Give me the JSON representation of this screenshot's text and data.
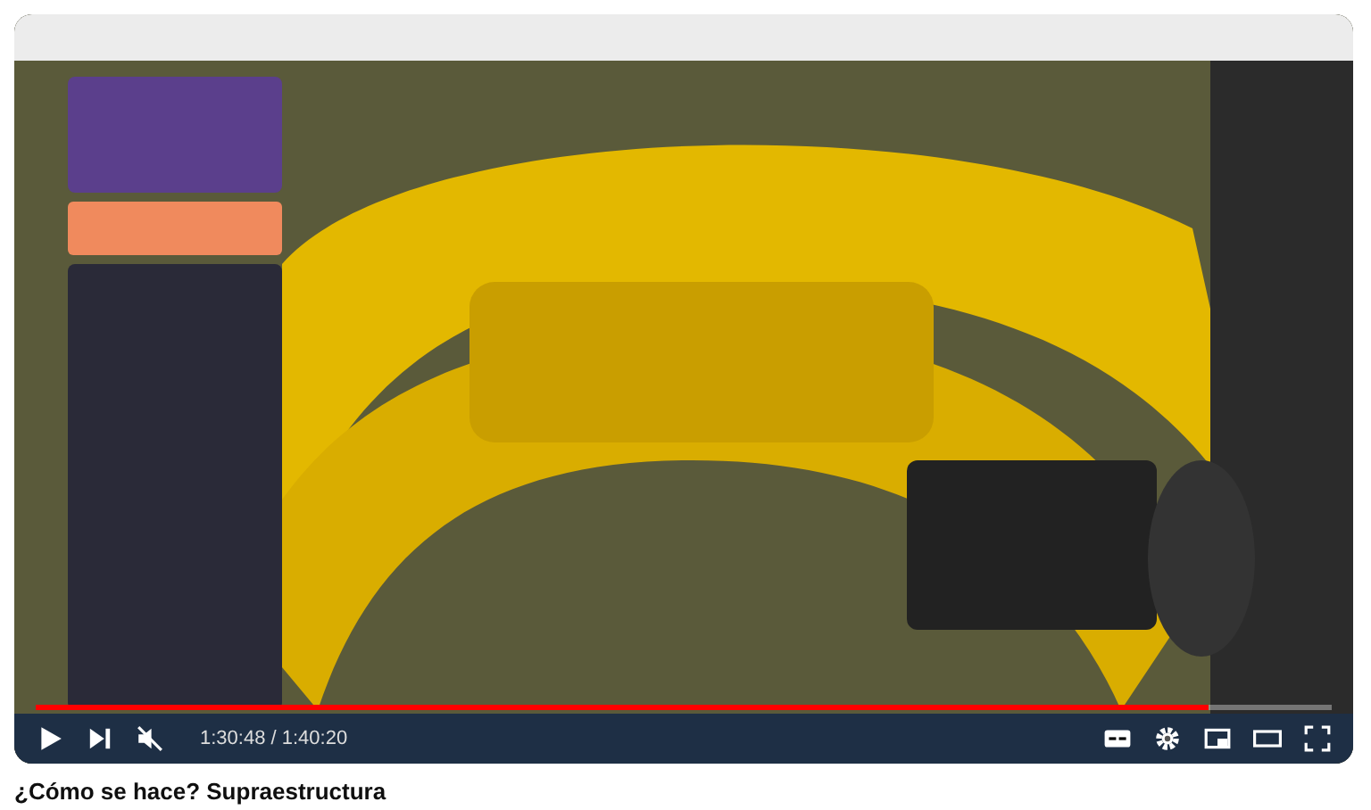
{
  "video": {
    "kind": "picture",
    "progress": {
      "level": 0.905
    },
    "time": "1:30:48 / 1:40:20"
  },
  "title": "¿Cómo se hace? Supraestructura"
}
